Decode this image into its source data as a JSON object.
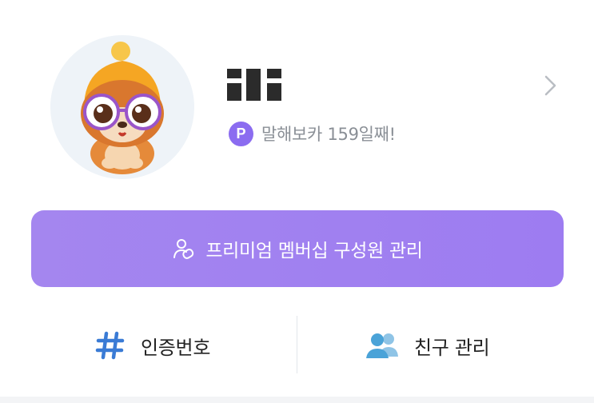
{
  "profile": {
    "avatar_icon": "character-avatar-icon",
    "streak_badge": "P",
    "streak_text": "말해보카 159일째!",
    "chevron_icon": "chevron-right-icon"
  },
  "premium": {
    "icon": "group-person-icon",
    "label": "프리미엄 멤버십 구성원 관리"
  },
  "bottom_menu": [
    {
      "label": "인증번호",
      "icon": "hashtag-icon",
      "color": "#3a7bd5"
    },
    {
      "label": "친구 관리",
      "icon": "friends-icon",
      "color": "#4aa3d8"
    }
  ],
  "colors": {
    "accent_purple": "#9d7cf1",
    "badge_purple": "#8b6cf0",
    "muted_text": "#8a8f96"
  }
}
